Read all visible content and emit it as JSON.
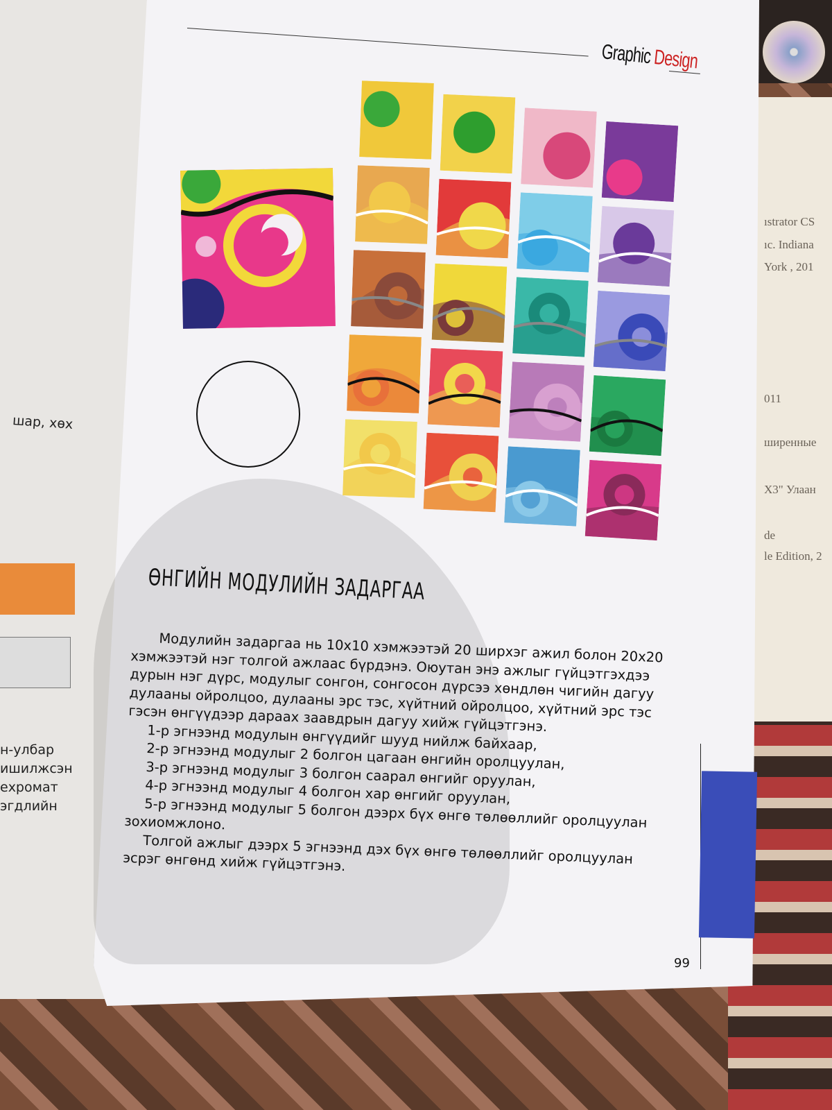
{
  "header": {
    "title_part1": "Graphic ",
    "title_part2": "Design"
  },
  "heading": "ӨНГИЙН МОДУЛИЙН ЗАДАРГАА",
  "body_lines": [
    "Модулийн задаргаа нь 10х10 хэмжээтэй  20 ширхэг ажил болон 20х20",
    "хэмжээтэй нэг толгой ажлаас бүрдэнэ. Оюутан энэ ажлыг гүйцэтгэхдээ",
    "дурын  нэг дүрс, модулыг сонгон, сонгосон дүрсээ хөндлөн чигийн дагуу",
    "дулааны ойролцоо, дулааны эрс тэс, хүйтний ойролцоо, хүйтний эрс тэс",
    "гэсэн өнгүүдээр дараах заавдрын дагуу хийж гүйцэтгэнэ.",
    "1-р эгнээнд модулын өнгүүдийг шууд нийлж байхаар,",
    "2-р эгнээнд модулыг 2 болгон цагаан өнгийн оролцуулан,",
    "3-р эгнээнд модулыг 3 болгон саарал өнгийг оруулан,",
    "4-р эгнээнд модулыг 4 болгон хар өнгийг оруулан,",
    "5-р эгнээнд модулыг 5 болгон дээрх бүх өнгө төлөөллийг оролцуулан",
    "зохиомжлоно.",
    "Толгой ажлыг дээрх 5 эгнээнд дэх бүх өнгө төлөөллийг оролцуулан",
    "эсрэг өнгөнд хийж гүйцэтгэнэ."
  ],
  "page_number": "99",
  "left_page": {
    "line1": "шар,  хөх",
    "line2": "н-улбар",
    "line3": "ишилжсэн",
    "line4": "ехромат",
    "line5": "эгдлийн"
  },
  "right_paper": [
    "ıstrator CS",
    "ıc. Indiana",
    "York , 201",
    "011",
    "ширенные",
    "X3\" Улаан",
    "de",
    "le Edition, 2"
  ],
  "colors": {
    "page": "#f4f3f6",
    "blue_block": "#3a4db8",
    "orange": "#e98b3a"
  },
  "tiles": [
    [
      "#f0c83a",
      "#3aa83a"
    ],
    [
      "#f2d24a",
      "#2e9e2e"
    ],
    [
      "#f0b8c8",
      "#d8487a"
    ],
    [
      "#7a3a9a",
      "#e83a8a"
    ],
    [
      "#e8a850",
      "#f2c84a"
    ],
    [
      "#e23a3a",
      "#f0d84a"
    ],
    [
      "#7fcde8",
      "#3aa8e0"
    ],
    [
      "#d8c8e8",
      "#6a3a9a"
    ],
    [
      "#c8703a",
      "#8a4a3a"
    ],
    [
      "#f0d83a",
      "#7a3a3a"
    ],
    [
      "#3ab8a8",
      "#1a8a7a"
    ],
    [
      "#9a9ae0",
      "#3a4ab8"
    ],
    [
      "#f0a83a",
      "#e8703a"
    ],
    [
      "#e84a5a",
      "#f2d84a"
    ],
    [
      "#b87ab8",
      "#d8a0d0"
    ],
    [
      "#2aa860",
      "#1a7a40"
    ],
    [
      "#f2e06a",
      "#f2c84a"
    ],
    [
      "#e8503a",
      "#f0d050"
    ],
    [
      "#4a9ad0",
      "#8ac8e8"
    ],
    [
      "#d83a8a",
      "#8a2a5a"
    ]
  ]
}
